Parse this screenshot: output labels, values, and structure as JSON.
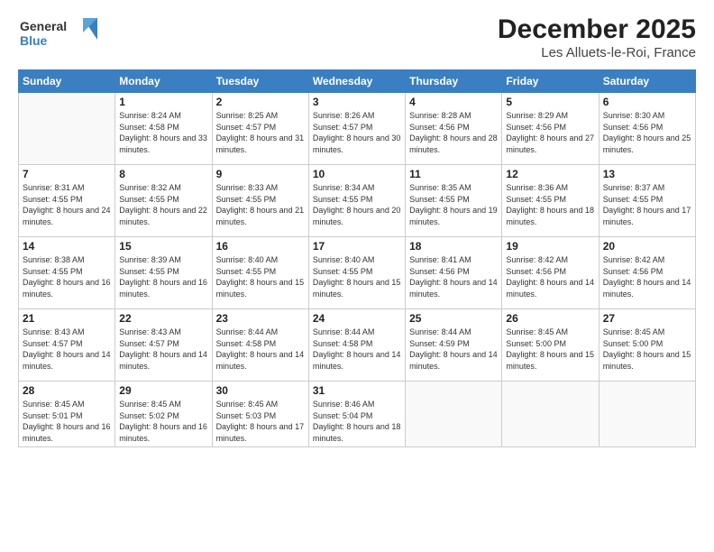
{
  "logo": {
    "line1": "General",
    "line2": "Blue"
  },
  "header": {
    "month_year": "December 2025",
    "location": "Les Alluets-le-Roi, France"
  },
  "days_of_week": [
    "Sunday",
    "Monday",
    "Tuesday",
    "Wednesday",
    "Thursday",
    "Friday",
    "Saturday"
  ],
  "weeks": [
    [
      {
        "num": "",
        "info": ""
      },
      {
        "num": "1",
        "info": "Sunrise: 8:24 AM\nSunset: 4:58 PM\nDaylight: 8 hours\nand 33 minutes."
      },
      {
        "num": "2",
        "info": "Sunrise: 8:25 AM\nSunset: 4:57 PM\nDaylight: 8 hours\nand 31 minutes."
      },
      {
        "num": "3",
        "info": "Sunrise: 8:26 AM\nSunset: 4:57 PM\nDaylight: 8 hours\nand 30 minutes."
      },
      {
        "num": "4",
        "info": "Sunrise: 8:28 AM\nSunset: 4:56 PM\nDaylight: 8 hours\nand 28 minutes."
      },
      {
        "num": "5",
        "info": "Sunrise: 8:29 AM\nSunset: 4:56 PM\nDaylight: 8 hours\nand 27 minutes."
      },
      {
        "num": "6",
        "info": "Sunrise: 8:30 AM\nSunset: 4:56 PM\nDaylight: 8 hours\nand 25 minutes."
      }
    ],
    [
      {
        "num": "7",
        "info": "Sunrise: 8:31 AM\nSunset: 4:55 PM\nDaylight: 8 hours\nand 24 minutes."
      },
      {
        "num": "8",
        "info": "Sunrise: 8:32 AM\nSunset: 4:55 PM\nDaylight: 8 hours\nand 22 minutes."
      },
      {
        "num": "9",
        "info": "Sunrise: 8:33 AM\nSunset: 4:55 PM\nDaylight: 8 hours\nand 21 minutes."
      },
      {
        "num": "10",
        "info": "Sunrise: 8:34 AM\nSunset: 4:55 PM\nDaylight: 8 hours\nand 20 minutes."
      },
      {
        "num": "11",
        "info": "Sunrise: 8:35 AM\nSunset: 4:55 PM\nDaylight: 8 hours\nand 19 minutes."
      },
      {
        "num": "12",
        "info": "Sunrise: 8:36 AM\nSunset: 4:55 PM\nDaylight: 8 hours\nand 18 minutes."
      },
      {
        "num": "13",
        "info": "Sunrise: 8:37 AM\nSunset: 4:55 PM\nDaylight: 8 hours\nand 17 minutes."
      }
    ],
    [
      {
        "num": "14",
        "info": "Sunrise: 8:38 AM\nSunset: 4:55 PM\nDaylight: 8 hours\nand 16 minutes."
      },
      {
        "num": "15",
        "info": "Sunrise: 8:39 AM\nSunset: 4:55 PM\nDaylight: 8 hours\nand 16 minutes."
      },
      {
        "num": "16",
        "info": "Sunrise: 8:40 AM\nSunset: 4:55 PM\nDaylight: 8 hours\nand 15 minutes."
      },
      {
        "num": "17",
        "info": "Sunrise: 8:40 AM\nSunset: 4:55 PM\nDaylight: 8 hours\nand 15 minutes."
      },
      {
        "num": "18",
        "info": "Sunrise: 8:41 AM\nSunset: 4:56 PM\nDaylight: 8 hours\nand 14 minutes."
      },
      {
        "num": "19",
        "info": "Sunrise: 8:42 AM\nSunset: 4:56 PM\nDaylight: 8 hours\nand 14 minutes."
      },
      {
        "num": "20",
        "info": "Sunrise: 8:42 AM\nSunset: 4:56 PM\nDaylight: 8 hours\nand 14 minutes."
      }
    ],
    [
      {
        "num": "21",
        "info": "Sunrise: 8:43 AM\nSunset: 4:57 PM\nDaylight: 8 hours\nand 14 minutes."
      },
      {
        "num": "22",
        "info": "Sunrise: 8:43 AM\nSunset: 4:57 PM\nDaylight: 8 hours\nand 14 minutes."
      },
      {
        "num": "23",
        "info": "Sunrise: 8:44 AM\nSunset: 4:58 PM\nDaylight: 8 hours\nand 14 minutes."
      },
      {
        "num": "24",
        "info": "Sunrise: 8:44 AM\nSunset: 4:58 PM\nDaylight: 8 hours\nand 14 minutes."
      },
      {
        "num": "25",
        "info": "Sunrise: 8:44 AM\nSunset: 4:59 PM\nDaylight: 8 hours\nand 14 minutes."
      },
      {
        "num": "26",
        "info": "Sunrise: 8:45 AM\nSunset: 5:00 PM\nDaylight: 8 hours\nand 15 minutes."
      },
      {
        "num": "27",
        "info": "Sunrise: 8:45 AM\nSunset: 5:00 PM\nDaylight: 8 hours\nand 15 minutes."
      }
    ],
    [
      {
        "num": "28",
        "info": "Sunrise: 8:45 AM\nSunset: 5:01 PM\nDaylight: 8 hours\nand 16 minutes."
      },
      {
        "num": "29",
        "info": "Sunrise: 8:45 AM\nSunset: 5:02 PM\nDaylight: 8 hours\nand 16 minutes."
      },
      {
        "num": "30",
        "info": "Sunrise: 8:45 AM\nSunset: 5:03 PM\nDaylight: 8 hours\nand 17 minutes."
      },
      {
        "num": "31",
        "info": "Sunrise: 8:46 AM\nSunset: 5:04 PM\nDaylight: 8 hours\nand 18 minutes."
      },
      {
        "num": "",
        "info": ""
      },
      {
        "num": "",
        "info": ""
      },
      {
        "num": "",
        "info": ""
      }
    ]
  ]
}
